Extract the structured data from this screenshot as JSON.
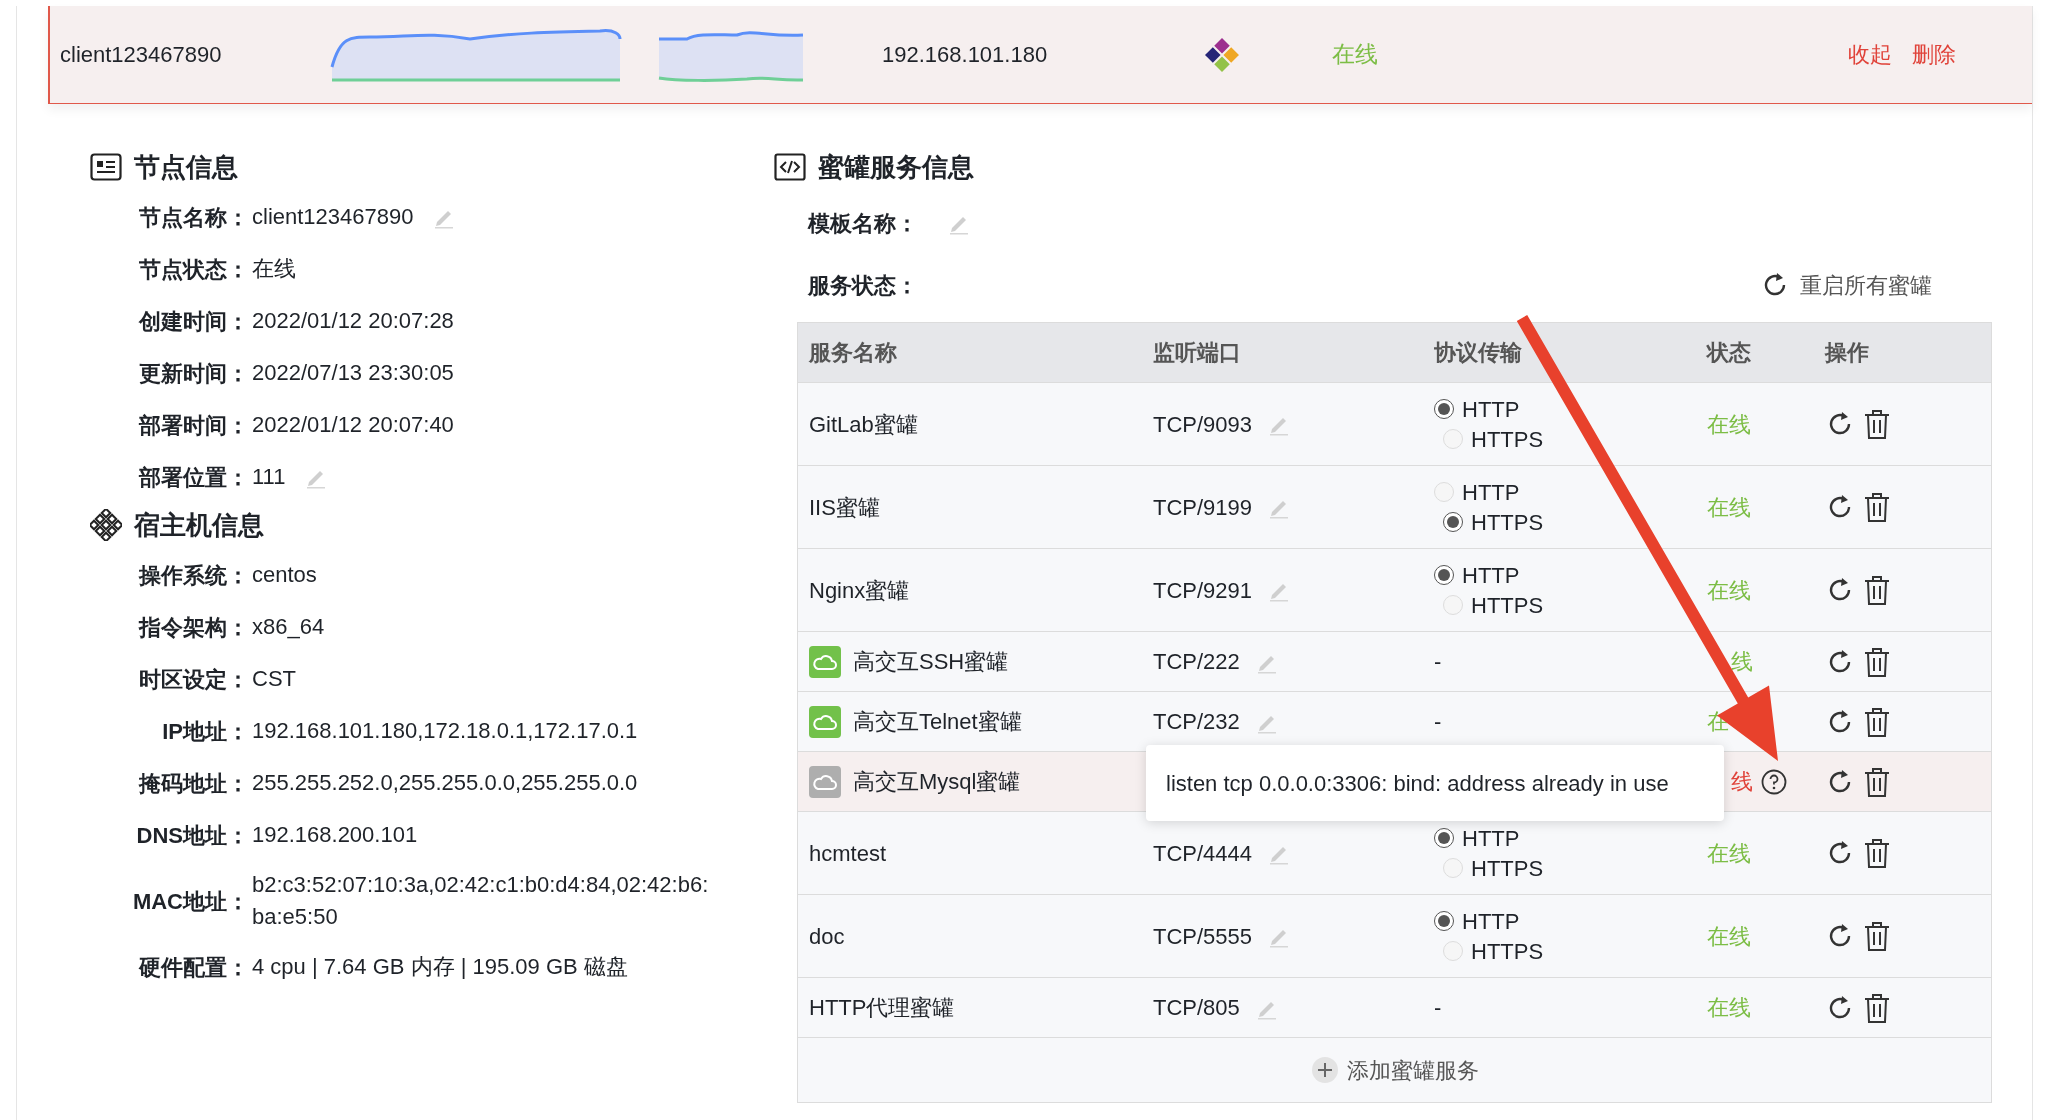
{
  "header": {
    "name": "client123467890",
    "ip": "192.168.101.180",
    "status": {
      "text": "在线",
      "online": true
    },
    "actions": [
      "收起",
      "删除"
    ]
  },
  "node_info": {
    "title": "节点信息",
    "fields": [
      {
        "label": "节点名称：",
        "value": "client123467890",
        "editable": true
      },
      {
        "label": "节点状态：",
        "value": "在线",
        "editable": false
      },
      {
        "label": "创建时间：",
        "value": "2022/01/12 20:07:28",
        "editable": false
      },
      {
        "label": "更新时间：",
        "value": "2022/07/13 23:30:05",
        "editable": false
      },
      {
        "label": "部署时间：",
        "value": "2022/01/12 20:07:40",
        "editable": false
      },
      {
        "label": "部署位置：",
        "value": "111",
        "editable": true
      }
    ]
  },
  "host_info": {
    "title": "宿主机信息",
    "fields": [
      {
        "label": "操作系统：",
        "value": "centos"
      },
      {
        "label": "指令架构：",
        "value": "x86_64"
      },
      {
        "label": "时区设定：",
        "value": "CST"
      },
      {
        "label": "IP地址：",
        "value": "192.168.101.180,172.18.0.1,172.17.0.1"
      },
      {
        "label": "掩码地址：",
        "value": "255.255.252.0,255.255.0.0,255.255.0.0"
      },
      {
        "label": "DNS地址：",
        "value": "192.168.200.101"
      },
      {
        "label": "MAC地址：",
        "value": "b2:c3:52:07:10:3a,02:42:c1:b0:d4:84,02:42:b6:ba:e5:50"
      },
      {
        "label": "硬件配置：",
        "value": "4 cpu | 7.64 GB 内存 | 195.09 GB 磁盘"
      }
    ]
  },
  "services": {
    "title": "蜜罐服务信息",
    "template_label": "模板名称：",
    "status_label": "服务状态：",
    "restart_all": "重启所有蜜罐",
    "columns": [
      "服务名称",
      "监听端口",
      "协议传输",
      "状态",
      "操作"
    ],
    "rows": [
      {
        "name": "GitLab蜜罐",
        "port": "TCP/9093",
        "protocol": [
          {
            "label": "HTTP",
            "selected": true
          },
          {
            "label": "HTTPS",
            "selected": false
          }
        ],
        "status": {
          "text": "在线",
          "online": true
        },
        "error": false
      },
      {
        "name": "IIS蜜罐",
        "port": "TCP/9199",
        "protocol": [
          {
            "label": "HTTP",
            "selected": false
          },
          {
            "label": "HTTPS",
            "selected": true
          }
        ],
        "status": {
          "text": "在线",
          "online": true
        },
        "error": false
      },
      {
        "name": "Nginx蜜罐",
        "port": "TCP/9291",
        "protocol": [
          {
            "label": "HTTP",
            "selected": true
          },
          {
            "label": "HTTPS",
            "selected": false
          }
        ],
        "status": {
          "text": "在线",
          "online": true
        },
        "error": false
      },
      {
        "name": "高交互SSH蜜罐",
        "cloud": true,
        "port": "TCP/222",
        "protocol_text": "-",
        "status": {
          "text": "线",
          "online": true
        },
        "error": false
      },
      {
        "name": "高交互Telnet蜜罐",
        "cloud": true,
        "port": "TCP/232",
        "protocol_text": "-",
        "status": {
          "text": "在",
          "online": true
        },
        "error": false
      },
      {
        "name": "高交互Mysql蜜罐",
        "cloud": false,
        "status": {
          "text": "线",
          "online": false
        },
        "error": true
      },
      {
        "name": "hcmtest",
        "port": "TCP/4444",
        "protocol": [
          {
            "label": "HTTP",
            "selected": true
          },
          {
            "label": "HTTPS",
            "selected": false
          }
        ],
        "status": {
          "text": "在线",
          "online": true
        },
        "error": false
      },
      {
        "name": "doc",
        "port": "TCP/5555",
        "protocol": [
          {
            "label": "HTTP",
            "selected": true
          },
          {
            "label": "HTTPS",
            "selected": false
          }
        ],
        "status": {
          "text": "在线",
          "online": true
        },
        "error": false
      },
      {
        "name": "HTTP代理蜜罐",
        "port": "TCP/805",
        "protocol_text": "-",
        "status": {
          "text": "在线",
          "online": true
        },
        "error": false
      }
    ],
    "add_button": "添加蜜罐服务"
  },
  "tooltip": {
    "text": "listen tcp 0.0.0.0:3306: bind: address already in use"
  }
}
